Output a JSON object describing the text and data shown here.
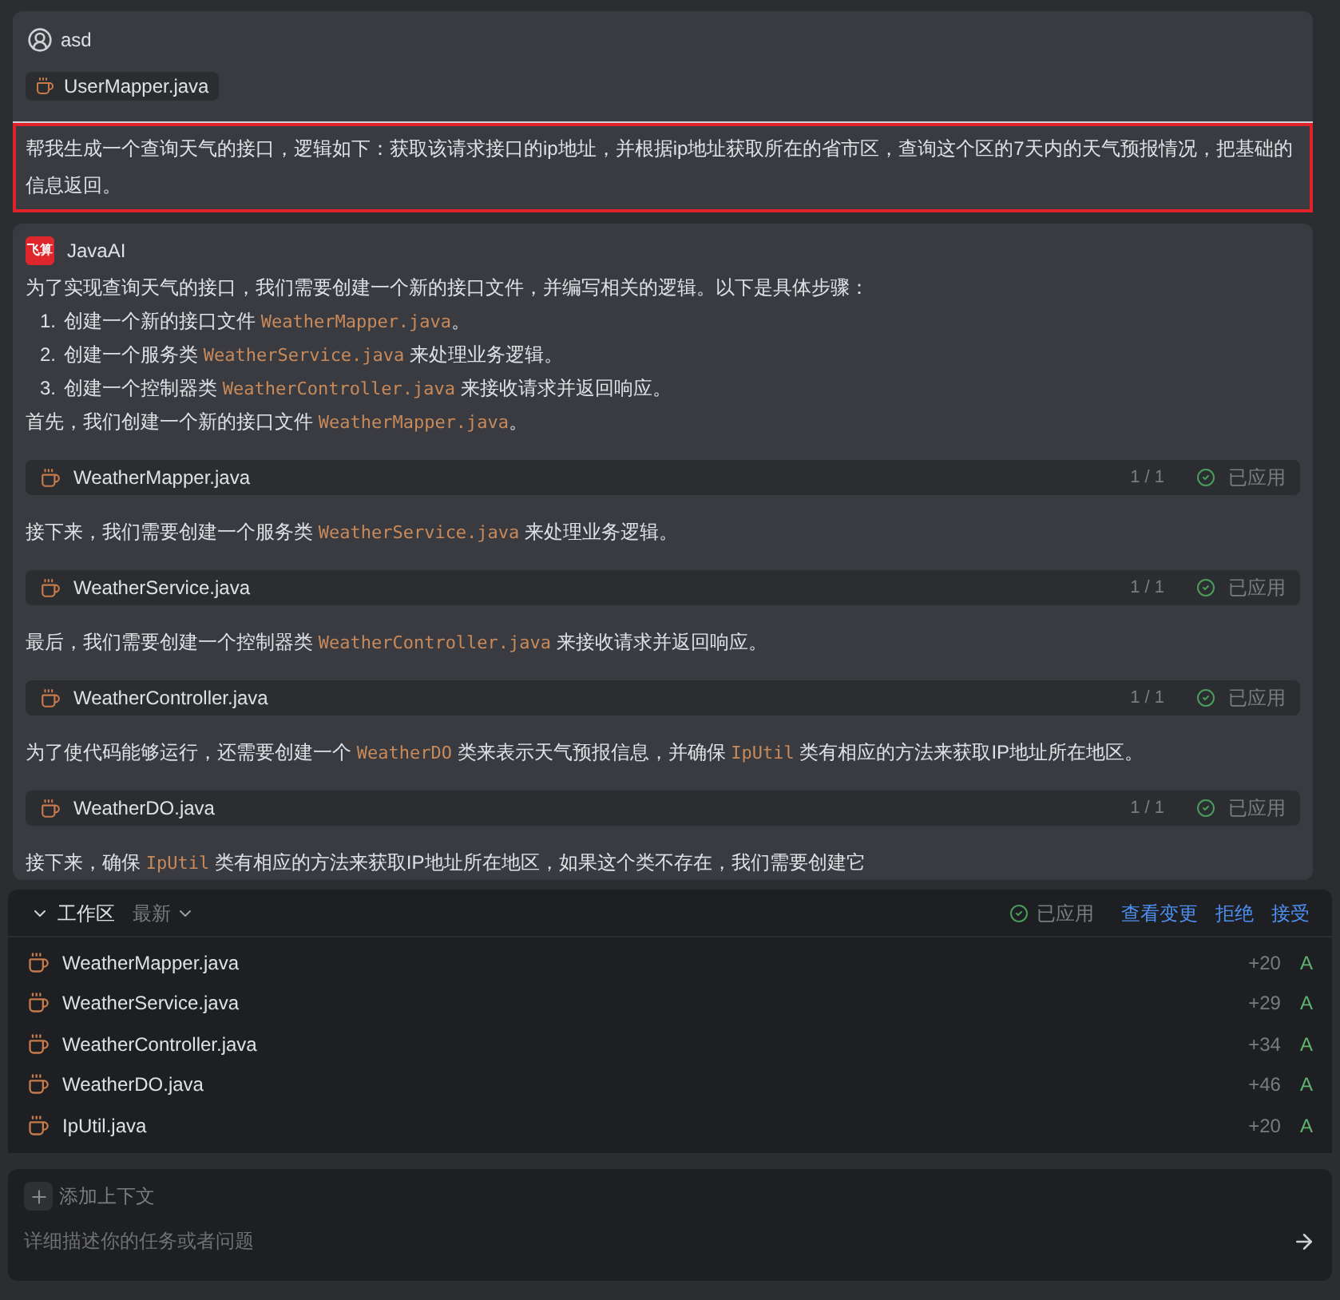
{
  "user_message": {
    "author": "asd",
    "attachment": "UserMapper.java",
    "prompt": "帮我生成一个查询天气的接口，逻辑如下：获取该请求接口的ip地址，并根据ip地址获取所在的省市区，查询这个区的7天内的天气预报情况，把基础的信息返回。"
  },
  "ai_message": {
    "logo": "飞算",
    "author": "JavaAI",
    "blocks": [
      {
        "kind": "paragraph",
        "segments": [
          {
            "text": "为了实现查询天气的接口，我们需要创建一个新的接口文件，并编写相关的逻辑。以下是具体步骤：",
            "code": false
          }
        ]
      },
      {
        "kind": "list",
        "items": [
          {
            "number": "1.",
            "segments": [
              {
                "text": "创建一个新的接口文件 ",
                "code": false
              },
              {
                "text": "WeatherMapper.java",
                "code": true
              },
              {
                "text": "。",
                "code": false
              }
            ]
          },
          {
            "number": "2.",
            "segments": [
              {
                "text": "创建一个服务类 ",
                "code": false
              },
              {
                "text": "WeatherService.java",
                "code": true
              },
              {
                "text": " 来处理业务逻辑。",
                "code": false
              }
            ]
          },
          {
            "number": "3.",
            "segments": [
              {
                "text": "创建一个控制器类 ",
                "code": false
              },
              {
                "text": "WeatherController.java",
                "code": true
              },
              {
                "text": " 来接收请求并返回响应。",
                "code": false
              }
            ]
          }
        ]
      },
      {
        "kind": "paragraph",
        "segments": [
          {
            "text": "首先，我们创建一个新的接口文件 ",
            "code": false
          },
          {
            "text": "WeatherMapper.java",
            "code": true
          },
          {
            "text": "。",
            "code": false
          }
        ]
      },
      {
        "kind": "file",
        "name": "WeatherMapper.java",
        "count": "1 / 1",
        "status": "已应用"
      },
      {
        "kind": "paragraph",
        "segments": [
          {
            "text": "接下来，我们需要创建一个服务类 ",
            "code": false
          },
          {
            "text": "WeatherService.java",
            "code": true
          },
          {
            "text": " 来处理业务逻辑。",
            "code": false
          }
        ]
      },
      {
        "kind": "file",
        "name": "WeatherService.java",
        "count": "1 / 1",
        "status": "已应用"
      },
      {
        "kind": "paragraph",
        "segments": [
          {
            "text": "最后，我们需要创建一个控制器类 ",
            "code": false
          },
          {
            "text": "WeatherController.java",
            "code": true
          },
          {
            "text": " 来接收请求并返回响应。",
            "code": false
          }
        ]
      },
      {
        "kind": "file",
        "name": "WeatherController.java",
        "count": "1 / 1",
        "status": "已应用"
      },
      {
        "kind": "paragraph",
        "segments": [
          {
            "text": "为了使代码能够运行，还需要创建一个 ",
            "code": false
          },
          {
            "text": "WeatherDO",
            "code": true
          },
          {
            "text": " 类来表示天气预报信息，并确保 ",
            "code": false
          },
          {
            "text": "IpUtil",
            "code": true
          },
          {
            "text": " 类有相应的方法来获取IP地址所在地区。",
            "code": false
          }
        ]
      },
      {
        "kind": "file",
        "name": "WeatherDO.java",
        "count": "1 / 1",
        "status": "已应用"
      },
      {
        "kind": "paragraph",
        "segments": [
          {
            "text": "接下来，确保 ",
            "code": false
          },
          {
            "text": "IpUtil",
            "code": true
          },
          {
            "text": " 类有相应的方法来获取IP地址所在地区，如果这个类不存在，我们需要创建它",
            "code": false
          }
        ]
      }
    ]
  },
  "workspace": {
    "expanded": true,
    "title": "工作区",
    "filter": "最新",
    "status": "已应用",
    "actions": [
      "查看变更",
      "拒绝",
      "接受"
    ],
    "files": [
      {
        "name": "WeatherMapper.java",
        "additions": "+20",
        "change": "A"
      },
      {
        "name": "WeatherService.java",
        "additions": "+29",
        "change": "A"
      },
      {
        "name": "WeatherController.java",
        "additions": "+34",
        "change": "A"
      },
      {
        "name": "WeatherDO.java",
        "additions": "+46",
        "change": "A"
      },
      {
        "name": "IpUtil.java",
        "additions": "+20",
        "change": "A"
      }
    ]
  },
  "composer": {
    "add_context": "添加上下文",
    "placeholder": "详细描述你的任务或者问题"
  }
}
